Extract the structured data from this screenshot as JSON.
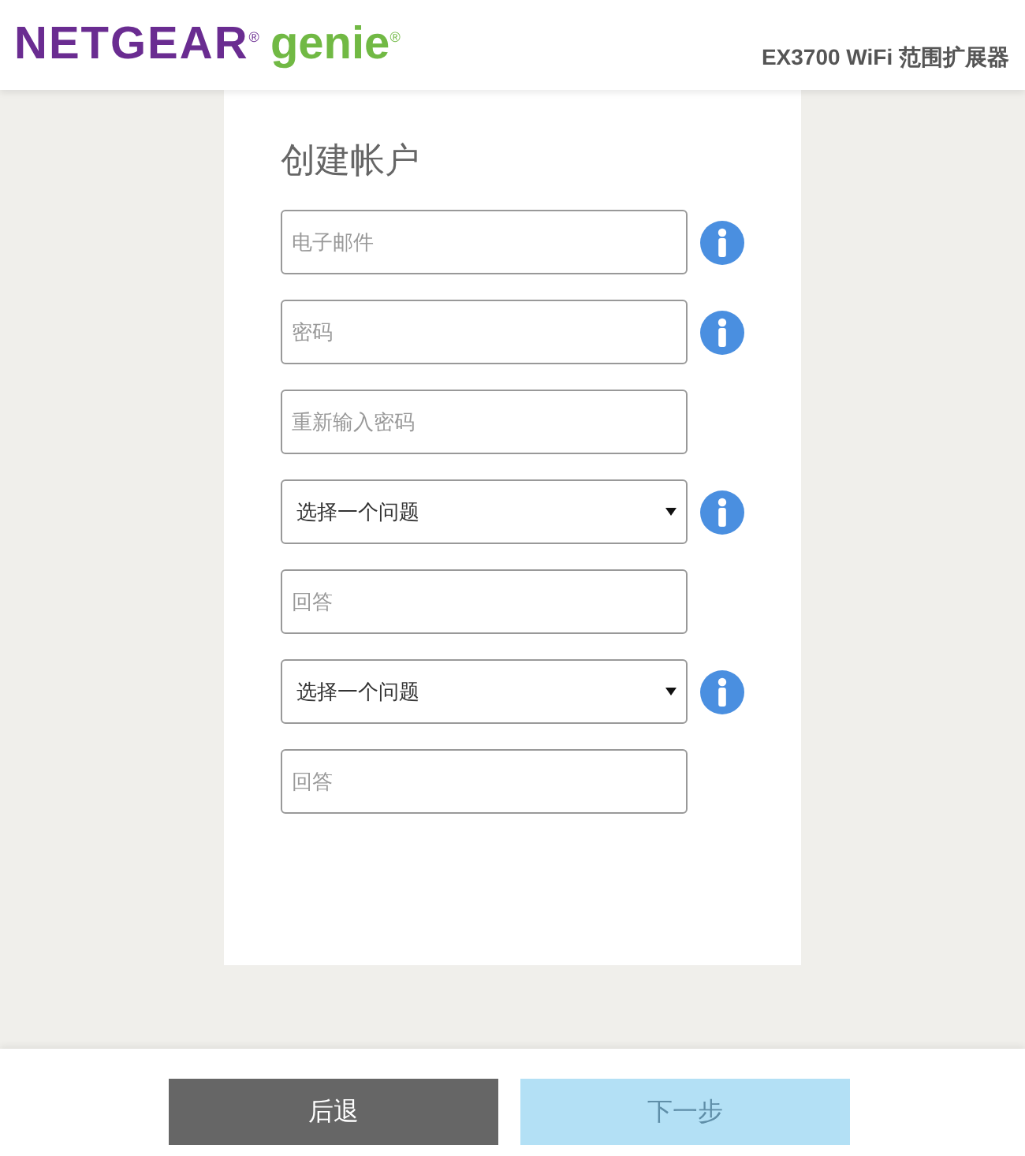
{
  "header": {
    "logo": {
      "brand": "NETGEAR$^{®}$",
      "product": "genie$^{®}$"
    },
    "device_title": "EX3700 WiFi 范围扩展器"
  },
  "form": {
    "title": "创建帐户",
    "fields": [
      {
        "kind": "input",
        "placeholder": "电子邮件",
        "info": true
      },
      {
        "kind": "input",
        "placeholder": "密码",
        "info": true
      },
      {
        "kind": "input",
        "placeholder": "重新输入密码",
        "info": false
      },
      {
        "kind": "select",
        "value": "选择一个问题",
        "info": true
      },
      {
        "kind": "input",
        "placeholder": "回答",
        "info": false
      },
      {
        "kind": "select",
        "value": "选择一个问题",
        "info": true
      },
      {
        "kind": "input",
        "placeholder": "回答",
        "info": false
      }
    ]
  },
  "buttons": [
    {
      "label": "后退",
      "disabled": false
    },
    {
      "label": "下一步",
      "disabled": true
    }
  ]
}
